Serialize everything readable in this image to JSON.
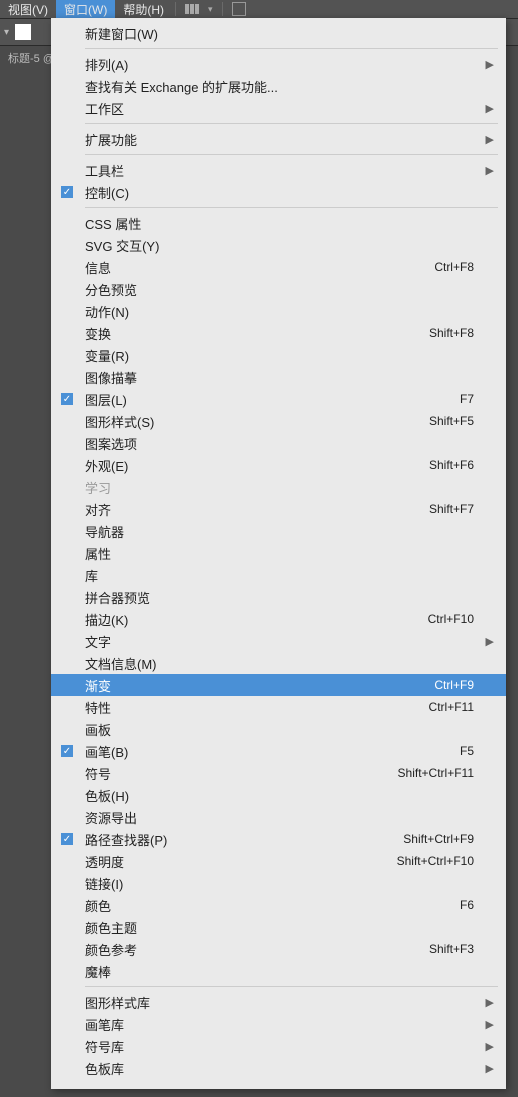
{
  "menubar": {
    "items": [
      {
        "label": "视图(V)"
      },
      {
        "label": "窗口(W)"
      },
      {
        "label": "帮助(H)"
      }
    ]
  },
  "tabLabel": "标题-5 @",
  "menu": {
    "sections": [
      [
        {
          "label": "新建窗口(W)",
          "checked": false,
          "submenu": false,
          "accel": "",
          "disabled": false
        }
      ],
      [
        {
          "label": "排列(A)",
          "checked": false,
          "submenu": true,
          "accel": "",
          "disabled": false
        },
        {
          "label": "查找有关 Exchange 的扩展功能...",
          "checked": false,
          "submenu": false,
          "accel": "",
          "disabled": false
        },
        {
          "label": "工作区",
          "checked": false,
          "submenu": true,
          "accel": "",
          "disabled": false
        }
      ],
      [
        {
          "label": "扩展功能",
          "checked": false,
          "submenu": true,
          "accel": "",
          "disabled": false
        }
      ],
      [
        {
          "label": "工具栏",
          "checked": false,
          "submenu": true,
          "accel": "",
          "disabled": false
        },
        {
          "label": "控制(C)",
          "checked": true,
          "submenu": false,
          "accel": "",
          "disabled": false
        }
      ],
      [
        {
          "label": "CSS 属性",
          "checked": false,
          "submenu": false,
          "accel": "",
          "disabled": false
        },
        {
          "label": "SVG 交互(Y)",
          "checked": false,
          "submenu": false,
          "accel": "",
          "disabled": false
        },
        {
          "label": "信息",
          "checked": false,
          "submenu": false,
          "accel": "Ctrl+F8",
          "disabled": false
        },
        {
          "label": "分色预览",
          "checked": false,
          "submenu": false,
          "accel": "",
          "disabled": false
        },
        {
          "label": "动作(N)",
          "checked": false,
          "submenu": false,
          "accel": "",
          "disabled": false
        },
        {
          "label": "变换",
          "checked": false,
          "submenu": false,
          "accel": "Shift+F8",
          "disabled": false
        },
        {
          "label": "变量(R)",
          "checked": false,
          "submenu": false,
          "accel": "",
          "disabled": false
        },
        {
          "label": "图像描摹",
          "checked": false,
          "submenu": false,
          "accel": "",
          "disabled": false
        },
        {
          "label": "图层(L)",
          "checked": true,
          "submenu": false,
          "accel": "F7",
          "disabled": false
        },
        {
          "label": "图形样式(S)",
          "checked": false,
          "submenu": false,
          "accel": "Shift+F5",
          "disabled": false
        },
        {
          "label": "图案选项",
          "checked": false,
          "submenu": false,
          "accel": "",
          "disabled": false
        },
        {
          "label": "外观(E)",
          "checked": false,
          "submenu": false,
          "accel": "Shift+F6",
          "disabled": false
        },
        {
          "label": "学习",
          "checked": false,
          "submenu": false,
          "accel": "",
          "disabled": true
        },
        {
          "label": "对齐",
          "checked": false,
          "submenu": false,
          "accel": "Shift+F7",
          "disabled": false
        },
        {
          "label": "导航器",
          "checked": false,
          "submenu": false,
          "accel": "",
          "disabled": false
        },
        {
          "label": "属性",
          "checked": false,
          "submenu": false,
          "accel": "",
          "disabled": false
        },
        {
          "label": "库",
          "checked": false,
          "submenu": false,
          "accel": "",
          "disabled": false
        },
        {
          "label": "拼合器预览",
          "checked": false,
          "submenu": false,
          "accel": "",
          "disabled": false
        },
        {
          "label": "描边(K)",
          "checked": false,
          "submenu": false,
          "accel": "Ctrl+F10",
          "disabled": false
        },
        {
          "label": "文字",
          "checked": false,
          "submenu": true,
          "accel": "",
          "disabled": false
        },
        {
          "label": "文档信息(M)",
          "checked": false,
          "submenu": false,
          "accel": "",
          "disabled": false
        },
        {
          "label": "渐变",
          "checked": false,
          "submenu": false,
          "accel": "Ctrl+F9",
          "disabled": false,
          "highlighted": true
        },
        {
          "label": "特性",
          "checked": false,
          "submenu": false,
          "accel": "Ctrl+F11",
          "disabled": false
        },
        {
          "label": "画板",
          "checked": false,
          "submenu": false,
          "accel": "",
          "disabled": false
        },
        {
          "label": "画笔(B)",
          "checked": true,
          "submenu": false,
          "accel": "F5",
          "disabled": false
        },
        {
          "label": "符号",
          "checked": false,
          "submenu": false,
          "accel": "Shift+Ctrl+F11",
          "disabled": false
        },
        {
          "label": "色板(H)",
          "checked": false,
          "submenu": false,
          "accel": "",
          "disabled": false
        },
        {
          "label": "资源导出",
          "checked": false,
          "submenu": false,
          "accel": "",
          "disabled": false
        },
        {
          "label": "路径查找器(P)",
          "checked": true,
          "submenu": false,
          "accel": "Shift+Ctrl+F9",
          "disabled": false
        },
        {
          "label": "透明度",
          "checked": false,
          "submenu": false,
          "accel": "Shift+Ctrl+F10",
          "disabled": false
        },
        {
          "label": "链接(I)",
          "checked": false,
          "submenu": false,
          "accel": "",
          "disabled": false
        },
        {
          "label": "颜色",
          "checked": false,
          "submenu": false,
          "accel": "F6",
          "disabled": false
        },
        {
          "label": "颜色主题",
          "checked": false,
          "submenu": false,
          "accel": "",
          "disabled": false
        },
        {
          "label": "颜色参考",
          "checked": false,
          "submenu": false,
          "accel": "Shift+F3",
          "disabled": false
        },
        {
          "label": "魔棒",
          "checked": false,
          "submenu": false,
          "accel": "",
          "disabled": false
        }
      ],
      [
        {
          "label": "图形样式库",
          "checked": false,
          "submenu": true,
          "accel": "",
          "disabled": false
        },
        {
          "label": "画笔库",
          "checked": false,
          "submenu": true,
          "accel": "",
          "disabled": false
        },
        {
          "label": "符号库",
          "checked": false,
          "submenu": true,
          "accel": "",
          "disabled": false
        },
        {
          "label": "色板库",
          "checked": false,
          "submenu": true,
          "accel": "",
          "disabled": false
        }
      ]
    ]
  }
}
